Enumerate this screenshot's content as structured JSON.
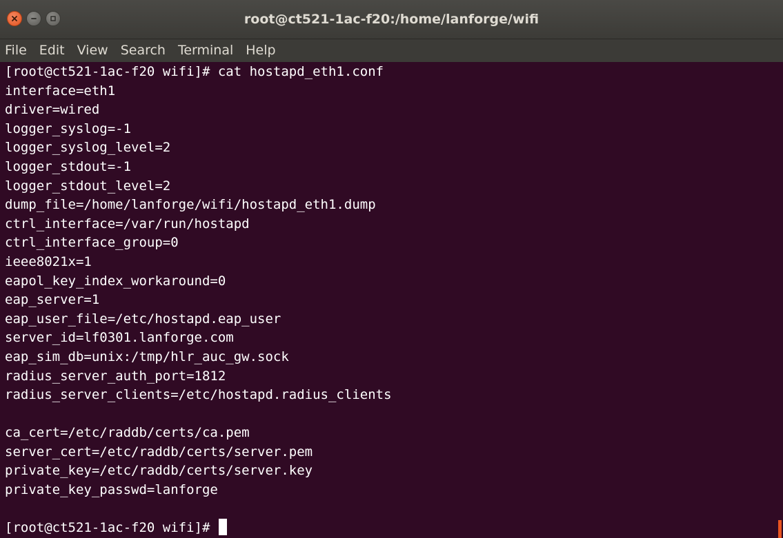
{
  "window": {
    "title": "root@ct521-1ac-f20:/home/lanforge/wifi",
    "controls": [
      "close-icon",
      "minimize-icon",
      "maximize-icon"
    ]
  },
  "menu": [
    "File",
    "Edit",
    "View",
    "Search",
    "Terminal",
    "Help"
  ],
  "terminal": {
    "lines": [
      "[root@ct521-1ac-f20 wifi]# cat hostapd_eth1.conf",
      "interface=eth1",
      "driver=wired",
      "logger_syslog=-1",
      "logger_syslog_level=2",
      "logger_stdout=-1",
      "logger_stdout_level=2",
      "dump_file=/home/lanforge/wifi/hostapd_eth1.dump",
      "ctrl_interface=/var/run/hostapd",
      "ctrl_interface_group=0",
      "ieee8021x=1",
      "eapol_key_index_workaround=0",
      "eap_server=1",
      "eap_user_file=/etc/hostapd.eap_user",
      "server_id=lf0301.lanforge.com",
      "eap_sim_db=unix:/tmp/hlr_auc_gw.sock",
      "radius_server_auth_port=1812",
      "radius_server_clients=/etc/hostapd.radius_clients",
      "",
      "ca_cert=/etc/raddb/certs/ca.pem",
      "server_cert=/etc/raddb/certs/server.pem",
      "private_key=/etc/raddb/certs/server.key",
      "private_key_passwd=lanforge",
      ""
    ],
    "prompt": "[root@ct521-1ac-f20 wifi]# "
  },
  "colors": {
    "terminal_bg": "#300a24",
    "text": "#ffffff",
    "titlebar": "#3c3b37",
    "accent": "#e95420"
  }
}
